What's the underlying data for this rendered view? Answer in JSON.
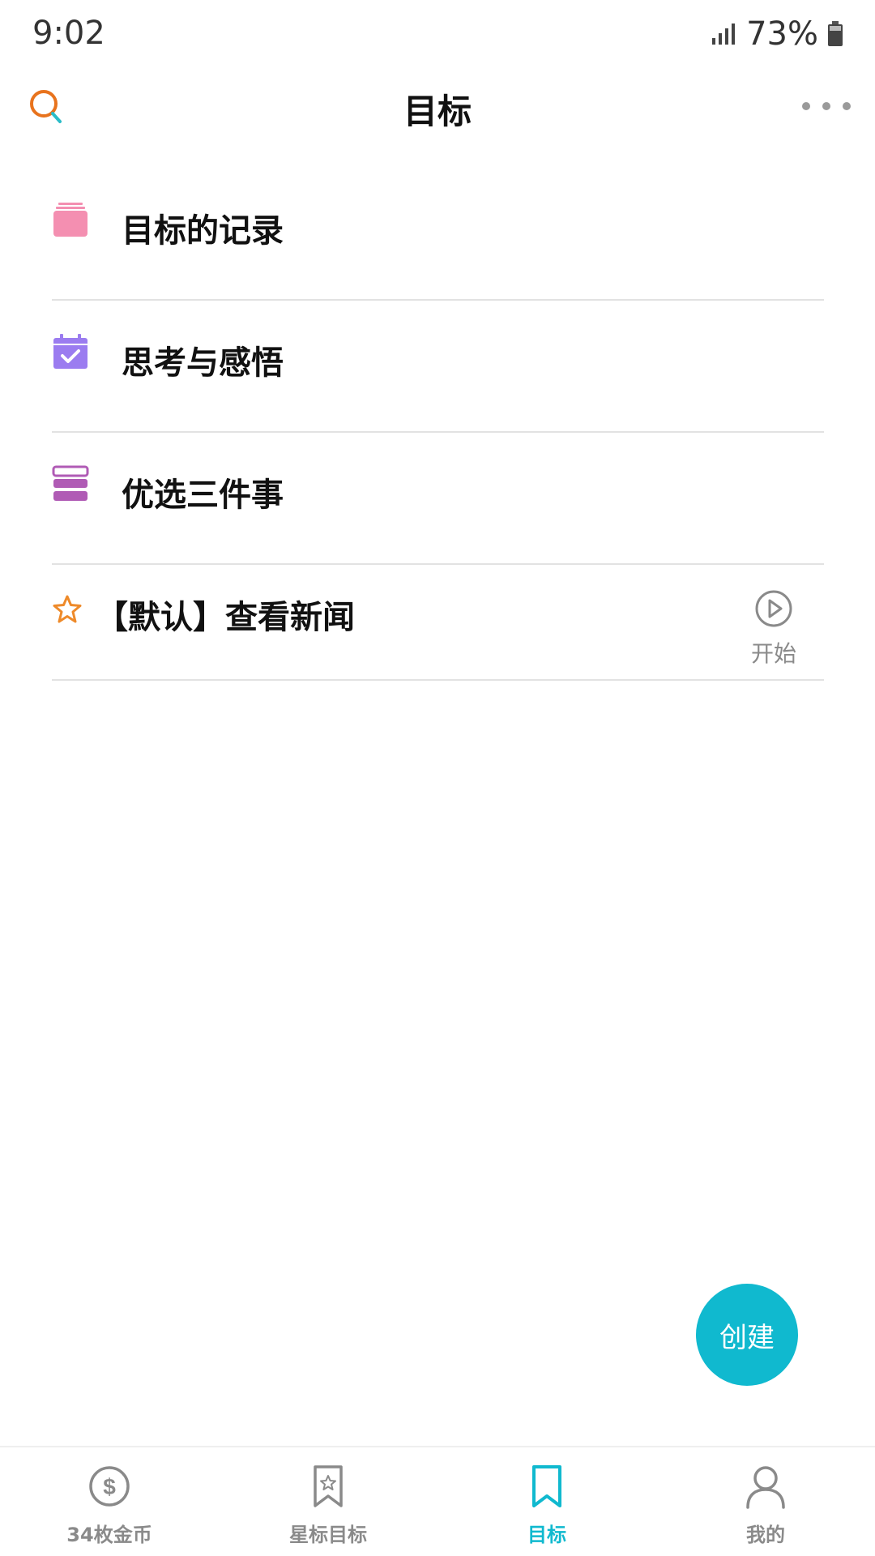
{
  "status_bar": {
    "time": "9:02",
    "battery": "73%"
  },
  "header": {
    "title": "目标"
  },
  "list": {
    "items": [
      {
        "label": "目标的记录",
        "icon": "stacked-box-icon",
        "color": "#f48fb1"
      },
      {
        "label": "思考与感悟",
        "icon": "calendar-check-icon",
        "color": "#9b7cf0"
      },
      {
        "label": "优选三件事",
        "icon": "three-bars-icon",
        "color": "#b05bb5"
      }
    ],
    "goal": {
      "label": "【默认】查看新闻",
      "action_label": "开始",
      "icon": "star-outline-icon",
      "color": "#ee8a2a"
    }
  },
  "fab": {
    "label": "创建",
    "color": "#10b9cf"
  },
  "bottom_nav": {
    "items": [
      {
        "label": "34枚金币",
        "icon": "dollar-coin-icon"
      },
      {
        "label": "星标目标",
        "icon": "bookmark-star-icon"
      },
      {
        "label": "目标",
        "icon": "bookmark-icon",
        "active": true
      },
      {
        "label": "我的",
        "icon": "person-icon"
      }
    ],
    "active_color": "#10b9cf"
  }
}
